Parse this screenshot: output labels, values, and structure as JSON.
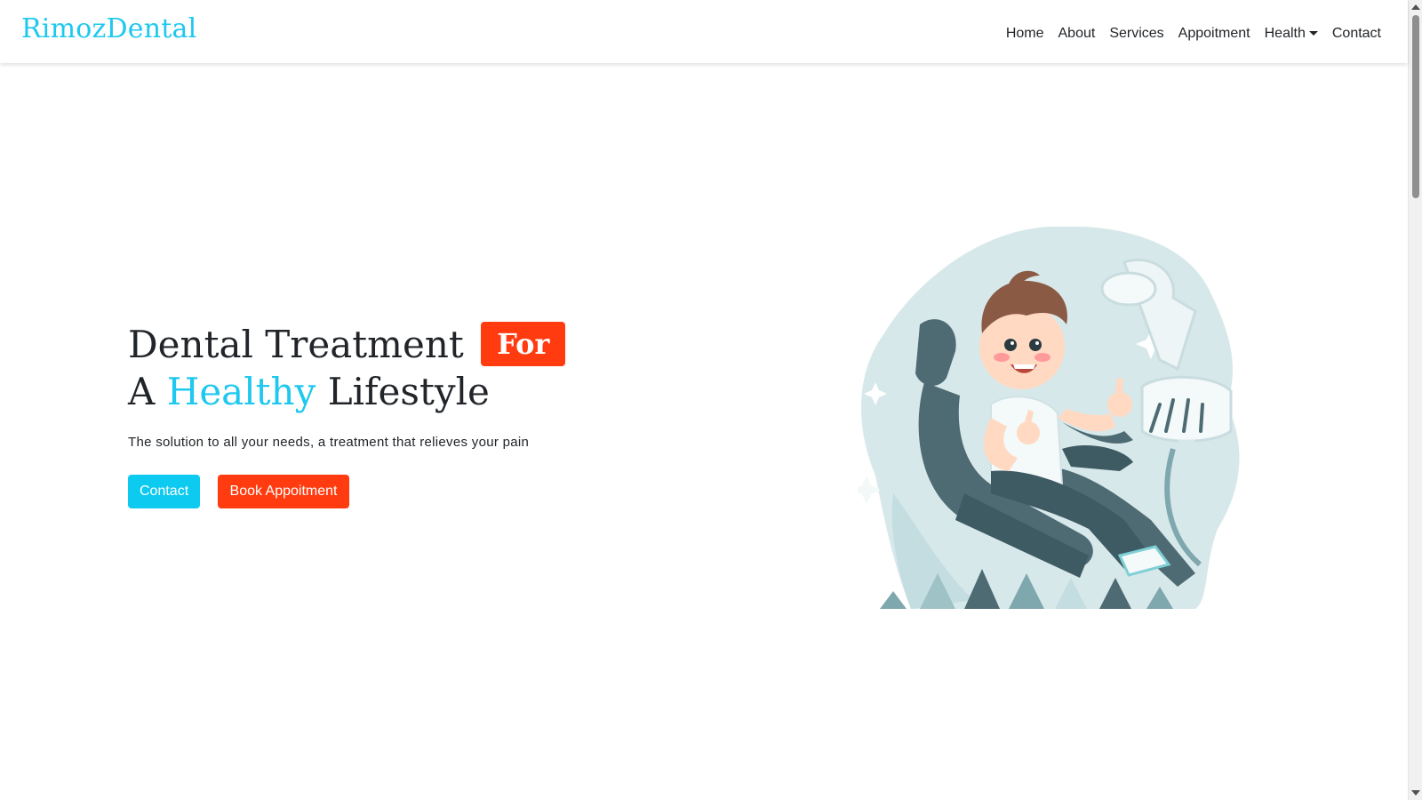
{
  "brand": {
    "name": "RimozDental"
  },
  "nav": {
    "items": [
      "Home",
      "About",
      "Services",
      "Appoitment",
      "Health",
      "Contact"
    ]
  },
  "hero": {
    "title_part1": "Dental Treatment",
    "title_badge": "For",
    "title_part2": "A",
    "title_accent": "Healthy",
    "title_part3": "Lifestyle",
    "subtitle": "The solution to all your needs, a treatment that relieves your pain",
    "contact_button": "Contact",
    "book_button": "Book Appoitment"
  },
  "illustration": {
    "icon": "child-in-dental-chair-illustration"
  },
  "colors": {
    "accent_cyan": "#1ec8ef",
    "button_cyan": "#0dcaf0",
    "accent_red": "#ff3b0f",
    "text_dark": "#212529"
  }
}
